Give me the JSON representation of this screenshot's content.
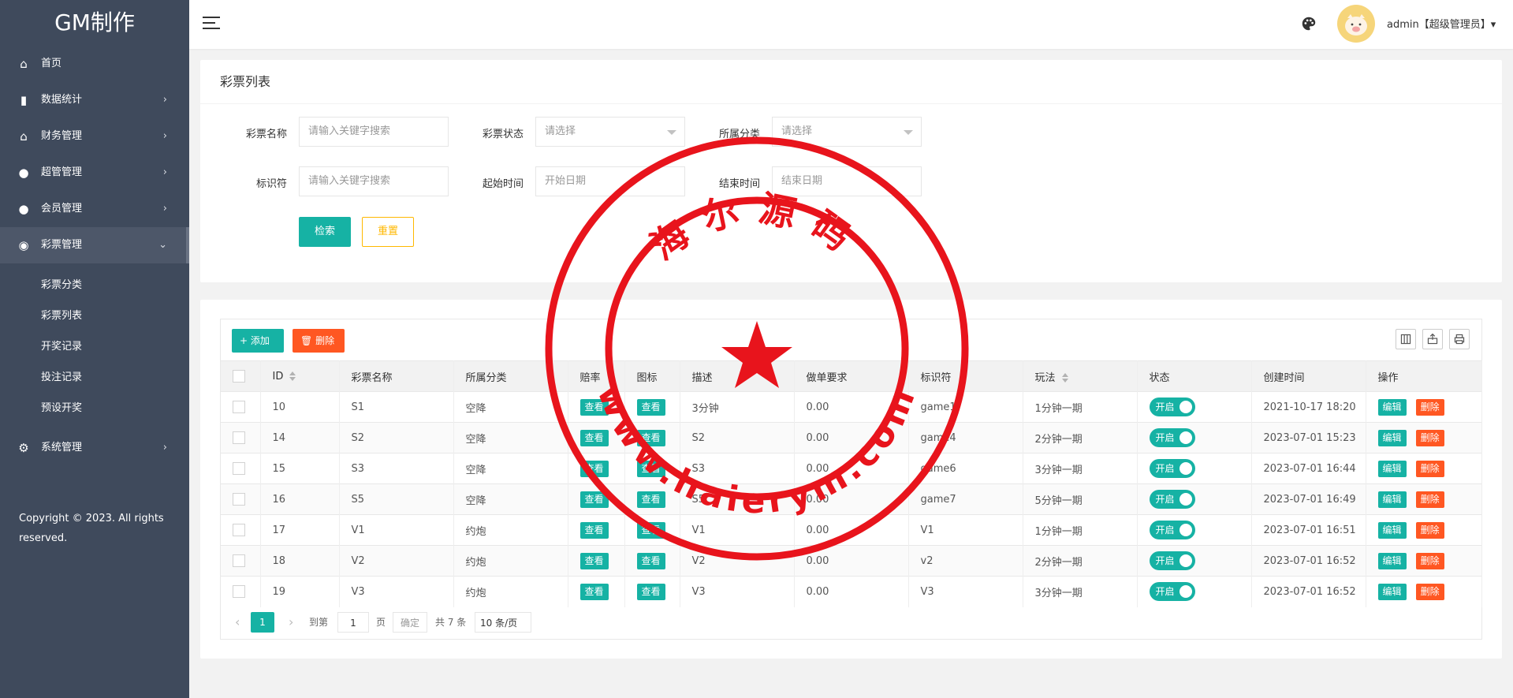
{
  "app": {
    "logo": "GM制作"
  },
  "sidebar": {
    "items": [
      {
        "label": "首页",
        "icon": "⌂",
        "arrow": ""
      },
      {
        "label": "数据统计",
        "icon": "▮",
        "arrow": "›"
      },
      {
        "label": "财务管理",
        "icon": "⌂",
        "arrow": "›"
      },
      {
        "label": "超管管理",
        "icon": "●",
        "arrow": "›"
      },
      {
        "label": "会员管理",
        "icon": "●",
        "arrow": "›"
      },
      {
        "label": "彩票管理",
        "icon": "◉",
        "arrow": "⌄"
      }
    ],
    "submenu": [
      "彩票分类",
      "彩票列表",
      "开奖记录",
      "投注记录",
      "预设开奖"
    ],
    "system": {
      "label": "系统管理",
      "icon": "⚙",
      "arrow": "›"
    },
    "copyright": "Copyright © 2023. All rights reserved."
  },
  "header": {
    "user": "admin【超级管理员】▾",
    "icons": [
      "menu-icon",
      "palette-icon",
      "avatar"
    ]
  },
  "search": {
    "title": "彩票列表",
    "name_label": "彩票名称",
    "name_placeholder": "请输入关键字搜索",
    "status_label": "彩票状态",
    "status_value": "请选择",
    "category_label": "所属分类",
    "category_value": "请选择",
    "code_label": "标识符",
    "code_placeholder": "请输入关键字搜索",
    "time_label": "起始时间",
    "start_placeholder": "开始日期",
    "end_label": "结束时间",
    "end_placeholder": "结束日期",
    "search_btn": "检索",
    "reset_btn": "重置"
  },
  "toolbar": {
    "add": "+ 添加",
    "delete": "删除"
  },
  "table": {
    "columns": [
      "",
      "ID",
      "彩票名称",
      "所属分类",
      "赔率",
      "图标",
      "描述",
      "做单要求",
      "标识符",
      "玩法",
      "状态",
      "创建时间",
      "操作"
    ],
    "view_label": "查看",
    "switch_label": "开启",
    "edit_label": "编辑",
    "delete_label": "删除",
    "rows": [
      {
        "id": "10",
        "name": "S1",
        "category": "空降",
        "desc": "3分钟",
        "req": "0.00",
        "code": "game1",
        "play": "1分钟一期",
        "created": "2021-10-17 18:20"
      },
      {
        "id": "14",
        "name": "S2",
        "category": "空降",
        "desc": "S2",
        "req": "0.00",
        "code": "game4",
        "play": "2分钟一期",
        "created": "2023-07-01 15:23"
      },
      {
        "id": "15",
        "name": "S3",
        "category": "空降",
        "desc": "S3",
        "req": "0.00",
        "code": "game6",
        "play": "3分钟一期",
        "created": "2023-07-01 16:44"
      },
      {
        "id": "16",
        "name": "S5",
        "category": "空降",
        "desc": "S5",
        "req": "0.00",
        "code": "game7",
        "play": "5分钟一期",
        "created": "2023-07-01 16:49"
      },
      {
        "id": "17",
        "name": "V1",
        "category": "约炮",
        "desc": "V1",
        "req": "0.00",
        "code": "V1",
        "play": "1分钟一期",
        "created": "2023-07-01 16:51"
      },
      {
        "id": "18",
        "name": "V2",
        "category": "约炮",
        "desc": "V2",
        "req": "0.00",
        "code": "v2",
        "play": "2分钟一期",
        "created": "2023-07-01 16:52"
      },
      {
        "id": "19",
        "name": "V3",
        "category": "约炮",
        "desc": "V3",
        "req": "0.00",
        "code": "V3",
        "play": "3分钟一期",
        "created": "2023-07-01 16:52"
      }
    ]
  },
  "pager": {
    "current": "1",
    "goto_label": "到第",
    "goto_value": "1",
    "page_label": "页",
    "ok_label": "确定",
    "total": "共 7 条",
    "size": "10 条/页"
  },
  "watermark": {
    "top_text": "海尔源码",
    "bottom_text": "www.haierym.com"
  },
  "colors": {
    "sidebar": "#3f4a5c",
    "primary": "#16b2a4",
    "danger": "#ff5722",
    "warning": "#ffb800",
    "stamp": "#e8141c"
  }
}
